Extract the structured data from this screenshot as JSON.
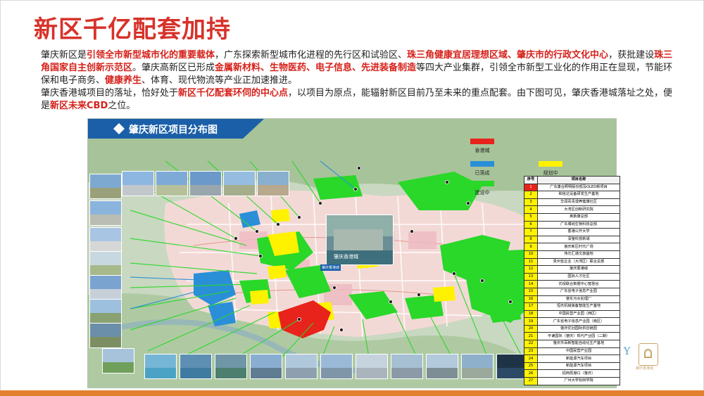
{
  "title": "新区千亿配套加持",
  "paragraph1": [
    {
      "t": "肇庆新区是",
      "h": false
    },
    {
      "t": "引领全市新型城市化的重要载体",
      "h": true
    },
    {
      "t": "，广东探索新型城市化进程的先行区和试验区、",
      "h": false
    },
    {
      "t": "珠三角健康宜居理想区域、肇庆市的行政文化中心",
      "h": true
    },
    {
      "t": "，获批建设",
      "h": false
    },
    {
      "t": "珠三角国家自主创新示范区",
      "h": true
    },
    {
      "t": "。肇庆高新区已形成",
      "h": false
    },
    {
      "t": "金属新材料、生物医药、电子信息、先进装备制造",
      "h": true
    },
    {
      "t": "等四大产业集群，引领全市新型工业化的作用正在显现，节能环保和电子商务、",
      "h": false
    },
    {
      "t": "健康养生",
      "h": true
    },
    {
      "t": "、体育、现代物流等产业正加速推进。",
      "h": false
    }
  ],
  "paragraph2": [
    {
      "t": "肇庆香港城项目的落址，恰好处于",
      "h": false
    },
    {
      "t": "新区千亿配套环伺的中心点",
      "h": true
    },
    {
      "t": "，以项目为原点，能辐射新区目前乃至未来的重点配套。由下图可见，肇庆香港城落址之处，便是",
      "h": false
    },
    {
      "t": "新区未来CBD",
      "h": true
    },
    {
      "t": "之位。",
      "h": false
    }
  ],
  "map": {
    "header_title": "肇庆新区项目分布图",
    "inset_label": "肇庆香港城",
    "project_label": "肇庆香港城",
    "legend": [
      {
        "label": "香港城",
        "color": "#e8231b"
      },
      {
        "label": "已落成",
        "color": "#2b8fd8"
      },
      {
        "label": "规划中",
        "color": "#fff200"
      },
      {
        "label": "建设中",
        "color": "#29d829"
      }
    ]
  },
  "table": {
    "headers": [
      "序号",
      "项目名称"
    ],
    "rows": [
      {
        "n": "1",
        "name": "广东康合照明股份部及OLED新项目"
      },
      {
        "n": "2",
        "name": "和信达设备研发生产基地"
      },
      {
        "n": "3",
        "name": "华润青青漠养健康社区"
      },
      {
        "n": "4",
        "name": "大湾区创新研究院"
      },
      {
        "n": "5",
        "name": "奥斯康总部"
      },
      {
        "n": "6",
        "name": "广东博纳生物科技总部"
      },
      {
        "n": "7",
        "name": "香港公开大学"
      },
      {
        "n": "8",
        "name": "深肇科技新城"
      },
      {
        "n": "9",
        "name": "肇庆新区时代广场"
      },
      {
        "n": "10",
        "name": "伟光汇通文旅基地"
      },
      {
        "n": "11",
        "name": "贵州省企业（大湾区）联合总部"
      },
      {
        "n": "12",
        "name": "肇庆香港城"
      },
      {
        "n": "13",
        "name": "国际人才社区"
      },
      {
        "n": "14",
        "name": "优视联合数据中心智慧谷"
      },
      {
        "n": "15",
        "name": "广东省电子信息产业园"
      },
      {
        "n": "16",
        "name": "肇东污水处理厂"
      },
      {
        "n": "17",
        "name": "恒杰机械装备智能生产基地"
      },
      {
        "n": "18",
        "name": "中国民营产业园（西区）"
      },
      {
        "n": "19",
        "name": "广东省电子信息产业园（南区）"
      },
      {
        "n": "20",
        "name": "肇庆优创国际供应链园"
      },
      {
        "n": "21",
        "name": "平谦国际（肇庆）现代产业园（二期）"
      },
      {
        "n": "22",
        "name": "肇庆市百新智能自动化生产基地"
      },
      {
        "n": "23",
        "name": "中国民营产业园"
      },
      {
        "n": "24",
        "name": "新能源汽车项目"
      },
      {
        "n": "25",
        "name": "新能源汽车项目"
      },
      {
        "n": "26",
        "name": "招商局港口（肇庆）"
      },
      {
        "n": "27",
        "name": "广州大学松田学院"
      }
    ]
  },
  "brand": {
    "letter": "Y",
    "text": "肇庆香港城"
  }
}
